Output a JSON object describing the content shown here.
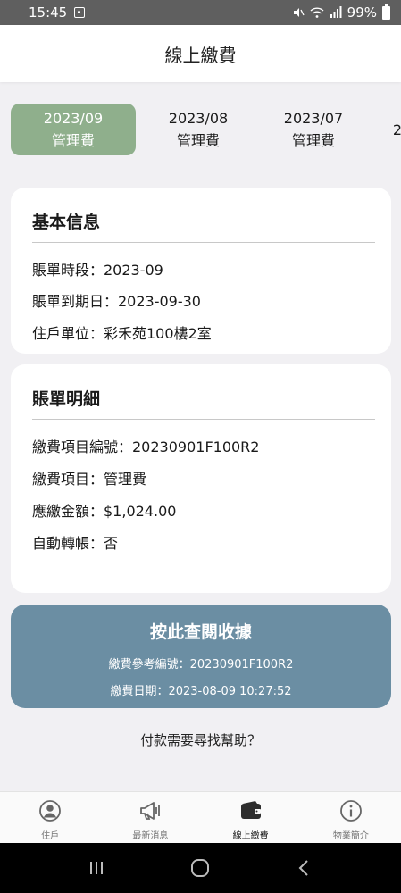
{
  "status_bar": {
    "time": "15:45",
    "battery": "99%"
  },
  "header": {
    "title": "線上繳費"
  },
  "periods": [
    {
      "month": "2023/09",
      "type": "管理費",
      "active": true
    },
    {
      "month": "2023/08",
      "type": "管理費",
      "active": false
    },
    {
      "month": "2023/07",
      "type": "管理費",
      "active": false
    },
    {
      "month": "2",
      "type": "",
      "active": false
    }
  ],
  "basic_info": {
    "title": "基本信息",
    "rows": [
      "賬單時段：2023-09",
      "賬單到期日：2023-09-30",
      "住戶單位：彩禾苑100樓2室"
    ]
  },
  "bill_detail": {
    "title": "賬單明細",
    "rows": [
      "繳費項目編號：20230901F100R2",
      "繳費項目：管理費",
      "應繳金額：$1,024.00",
      "自動轉帳：否"
    ]
  },
  "receipt": {
    "button_label": "按此查閱收據",
    "reference": "繳費參考編號：20230901F100R2",
    "payment_date": "繳費日期：2023-08-09 10:27:52"
  },
  "help": {
    "label": "付款需要尋找幫助？"
  },
  "bottom_nav": [
    {
      "icon": "user-circle-icon",
      "label": "住戶"
    },
    {
      "icon": "megaphone-icon",
      "label": "最新消息"
    },
    {
      "icon": "wallet-icon",
      "label": "線上繳費",
      "active": true
    },
    {
      "icon": "info-icon",
      "label": "物業簡介"
    }
  ],
  "colors": {
    "active_tab": "#8faf8c",
    "receipt_button": "#6b8ea3",
    "background": "#f1f0f3"
  }
}
